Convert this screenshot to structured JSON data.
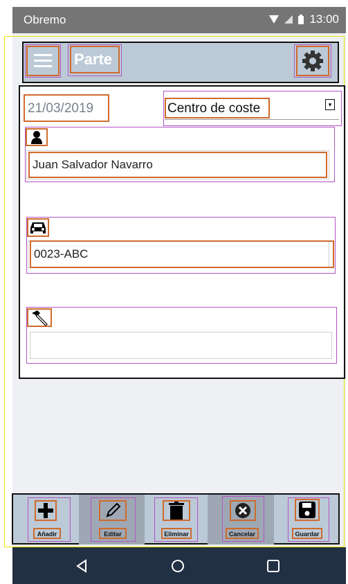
{
  "status_bar": {
    "carrier": "Obremo",
    "time": "13:00"
  },
  "toolbar": {
    "title": "Parte"
  },
  "form": {
    "date": "21/03/2019",
    "cost_center": {
      "selected": "Centro de coste"
    },
    "driver": {
      "value": "Juan Salvador Navarro"
    },
    "vehicle": {
      "value": "0023-ABC"
    },
    "task": {
      "value": ""
    }
  },
  "actions": {
    "add": "Añadir",
    "edit": "Editar",
    "delete": "Eliminar",
    "cancel": "Cancelar",
    "save": "Guardar"
  },
  "icons": {
    "menu": "menu-icon",
    "settings": "gear-icon",
    "driver": "person-icon",
    "vehicle": "car-icon",
    "task": "hammer-icon",
    "add": "plus-icon",
    "edit": "pencil-icon",
    "delete": "trash-icon",
    "cancel": "cancel-icon",
    "save": "floppy-disk-icon"
  },
  "colors": {
    "toolbar": "#bcc9d6",
    "navbar": "#223044",
    "statusbar": "#757575"
  }
}
